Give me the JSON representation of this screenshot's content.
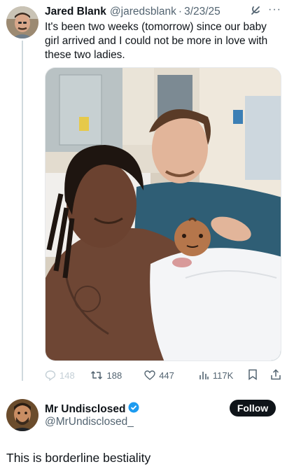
{
  "tweet": {
    "author_name": "Jared Blank",
    "author_handle": "@jaredsblank",
    "separator": "·",
    "date": "3/23/25",
    "text": "It's been two weeks (tomorrow) since our baby girl arrived and I could not be more in love with these two ladies.",
    "media_description_icon": "photo",
    "actions": {
      "replies": "148",
      "retweets": "188",
      "likes": "447",
      "views": "117K"
    }
  },
  "reply": {
    "author_name": "Mr Undisclosed",
    "author_handle": "@MrUndisclosed_",
    "follow_label": "Follow",
    "text": "This is borderline bestiality"
  },
  "colors": {
    "text_primary": "#0f1419",
    "text_secondary": "#536471",
    "verified_blue": "#1d9bf0",
    "thread_line": "#cfd9de",
    "follow_bg": "#0f1419"
  },
  "icons": [
    "grok-icon",
    "more-icon",
    "reply-icon",
    "retweet-icon",
    "like-icon",
    "views-icon",
    "bookmark-icon",
    "share-icon",
    "verified-badge-icon",
    "baby-emoji"
  ]
}
